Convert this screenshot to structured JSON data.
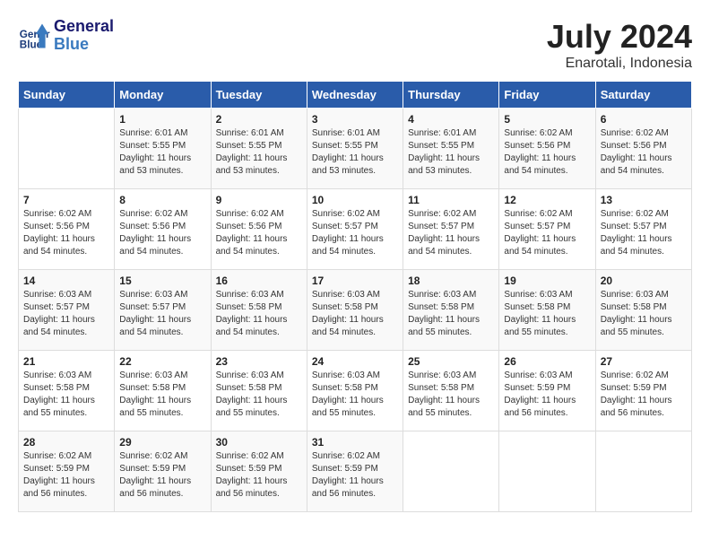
{
  "header": {
    "logo_line1": "General",
    "logo_line2": "Blue",
    "month_year": "July 2024",
    "location": "Enarotali, Indonesia"
  },
  "weekdays": [
    "Sunday",
    "Monday",
    "Tuesday",
    "Wednesday",
    "Thursday",
    "Friday",
    "Saturday"
  ],
  "weeks": [
    [
      {
        "day": "",
        "info": ""
      },
      {
        "day": "1",
        "info": "Sunrise: 6:01 AM\nSunset: 5:55 PM\nDaylight: 11 hours\nand 53 minutes."
      },
      {
        "day": "2",
        "info": "Sunrise: 6:01 AM\nSunset: 5:55 PM\nDaylight: 11 hours\nand 53 minutes."
      },
      {
        "day": "3",
        "info": "Sunrise: 6:01 AM\nSunset: 5:55 PM\nDaylight: 11 hours\nand 53 minutes."
      },
      {
        "day": "4",
        "info": "Sunrise: 6:01 AM\nSunset: 5:55 PM\nDaylight: 11 hours\nand 53 minutes."
      },
      {
        "day": "5",
        "info": "Sunrise: 6:02 AM\nSunset: 5:56 PM\nDaylight: 11 hours\nand 54 minutes."
      },
      {
        "day": "6",
        "info": "Sunrise: 6:02 AM\nSunset: 5:56 PM\nDaylight: 11 hours\nand 54 minutes."
      }
    ],
    [
      {
        "day": "7",
        "info": "Sunrise: 6:02 AM\nSunset: 5:56 PM\nDaylight: 11 hours\nand 54 minutes."
      },
      {
        "day": "8",
        "info": "Sunrise: 6:02 AM\nSunset: 5:56 PM\nDaylight: 11 hours\nand 54 minutes."
      },
      {
        "day": "9",
        "info": "Sunrise: 6:02 AM\nSunset: 5:56 PM\nDaylight: 11 hours\nand 54 minutes."
      },
      {
        "day": "10",
        "info": "Sunrise: 6:02 AM\nSunset: 5:57 PM\nDaylight: 11 hours\nand 54 minutes."
      },
      {
        "day": "11",
        "info": "Sunrise: 6:02 AM\nSunset: 5:57 PM\nDaylight: 11 hours\nand 54 minutes."
      },
      {
        "day": "12",
        "info": "Sunrise: 6:02 AM\nSunset: 5:57 PM\nDaylight: 11 hours\nand 54 minutes."
      },
      {
        "day": "13",
        "info": "Sunrise: 6:02 AM\nSunset: 5:57 PM\nDaylight: 11 hours\nand 54 minutes."
      }
    ],
    [
      {
        "day": "14",
        "info": "Sunrise: 6:03 AM\nSunset: 5:57 PM\nDaylight: 11 hours\nand 54 minutes."
      },
      {
        "day": "15",
        "info": "Sunrise: 6:03 AM\nSunset: 5:57 PM\nDaylight: 11 hours\nand 54 minutes."
      },
      {
        "day": "16",
        "info": "Sunrise: 6:03 AM\nSunset: 5:58 PM\nDaylight: 11 hours\nand 54 minutes."
      },
      {
        "day": "17",
        "info": "Sunrise: 6:03 AM\nSunset: 5:58 PM\nDaylight: 11 hours\nand 54 minutes."
      },
      {
        "day": "18",
        "info": "Sunrise: 6:03 AM\nSunset: 5:58 PM\nDaylight: 11 hours\nand 55 minutes."
      },
      {
        "day": "19",
        "info": "Sunrise: 6:03 AM\nSunset: 5:58 PM\nDaylight: 11 hours\nand 55 minutes."
      },
      {
        "day": "20",
        "info": "Sunrise: 6:03 AM\nSunset: 5:58 PM\nDaylight: 11 hours\nand 55 minutes."
      }
    ],
    [
      {
        "day": "21",
        "info": "Sunrise: 6:03 AM\nSunset: 5:58 PM\nDaylight: 11 hours\nand 55 minutes."
      },
      {
        "day": "22",
        "info": "Sunrise: 6:03 AM\nSunset: 5:58 PM\nDaylight: 11 hours\nand 55 minutes."
      },
      {
        "day": "23",
        "info": "Sunrise: 6:03 AM\nSunset: 5:58 PM\nDaylight: 11 hours\nand 55 minutes."
      },
      {
        "day": "24",
        "info": "Sunrise: 6:03 AM\nSunset: 5:58 PM\nDaylight: 11 hours\nand 55 minutes."
      },
      {
        "day": "25",
        "info": "Sunrise: 6:03 AM\nSunset: 5:58 PM\nDaylight: 11 hours\nand 55 minutes."
      },
      {
        "day": "26",
        "info": "Sunrise: 6:03 AM\nSunset: 5:59 PM\nDaylight: 11 hours\nand 56 minutes."
      },
      {
        "day": "27",
        "info": "Sunrise: 6:02 AM\nSunset: 5:59 PM\nDaylight: 11 hours\nand 56 minutes."
      }
    ],
    [
      {
        "day": "28",
        "info": "Sunrise: 6:02 AM\nSunset: 5:59 PM\nDaylight: 11 hours\nand 56 minutes."
      },
      {
        "day": "29",
        "info": "Sunrise: 6:02 AM\nSunset: 5:59 PM\nDaylight: 11 hours\nand 56 minutes."
      },
      {
        "day": "30",
        "info": "Sunrise: 6:02 AM\nSunset: 5:59 PM\nDaylight: 11 hours\nand 56 minutes."
      },
      {
        "day": "31",
        "info": "Sunrise: 6:02 AM\nSunset: 5:59 PM\nDaylight: 11 hours\nand 56 minutes."
      },
      {
        "day": "",
        "info": ""
      },
      {
        "day": "",
        "info": ""
      },
      {
        "day": "",
        "info": ""
      }
    ]
  ]
}
